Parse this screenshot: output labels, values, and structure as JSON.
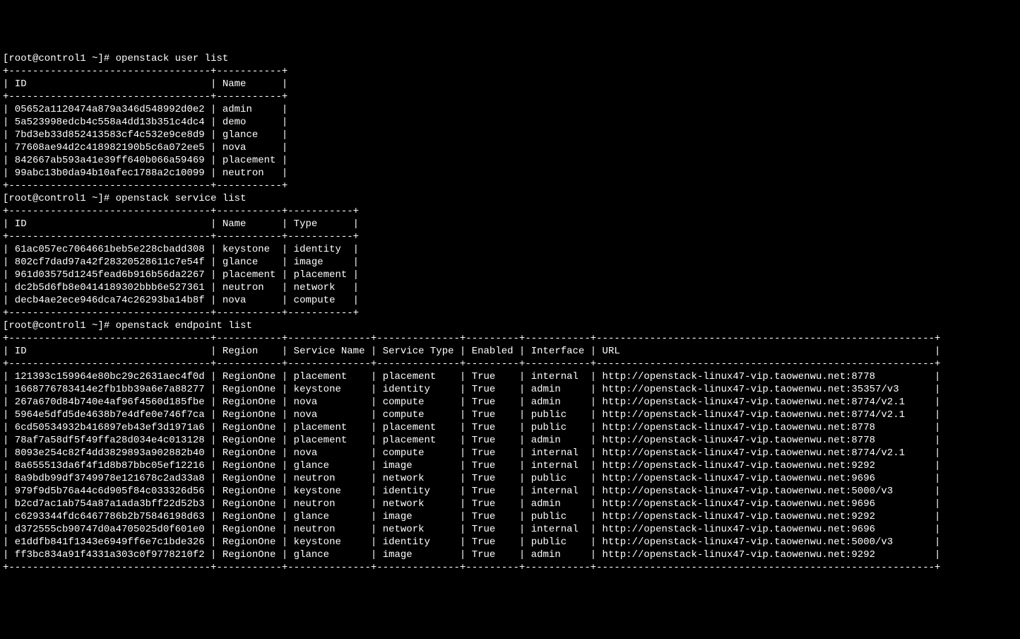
{
  "prompt": "[root@control1 ~]# ",
  "commands": {
    "user_list": "openstack user list",
    "service_list": "openstack service list",
    "endpoint_list": "openstack endpoint list"
  },
  "user_table": {
    "headers": [
      "ID",
      "Name"
    ],
    "widths": [
      34,
      11
    ],
    "rows": [
      [
        "05652a1120474a879a346d548992d0e2",
        "admin"
      ],
      [
        "5a523998edcb4c558a4dd13b351c4dc4",
        "demo"
      ],
      [
        "7bd3eb33d852413583cf4c532e9ce8d9",
        "glance"
      ],
      [
        "77608ae94d2c418982190b5c6a072ee5",
        "nova"
      ],
      [
        "842667ab593a41e39ff640b066a59469",
        "placement"
      ],
      [
        "99abc13b0da94b10afec1788a2c10099",
        "neutron"
      ]
    ]
  },
  "service_table": {
    "headers": [
      "ID",
      "Name",
      "Type"
    ],
    "widths": [
      34,
      11,
      11
    ],
    "rows": [
      [
        "61ac057ec7064661beb5e228cbadd308",
        "keystone",
        "identity"
      ],
      [
        "802cf7dad97a42f28320528611c7e54f",
        "glance",
        "image"
      ],
      [
        "961d03575d1245fead6b916b56da2267",
        "placement",
        "placement"
      ],
      [
        "dc2b5d6fb8e0414189302bbb6e527361",
        "neutron",
        "network"
      ],
      [
        "decb4ae2ece946dca74c26293ba14b8f",
        "nova",
        "compute"
      ]
    ]
  },
  "endpoint_table": {
    "headers": [
      "ID",
      "Region",
      "Service Name",
      "Service Type",
      "Enabled",
      "Interface",
      "URL"
    ],
    "widths": [
      34,
      11,
      14,
      14,
      9,
      11,
      57
    ],
    "rows": [
      [
        "121393c159964e80bc29c2631aec4f0d",
        "RegionOne",
        "placement",
        "placement",
        "True",
        "internal",
        "http://openstack-linux47-vip.taowenwu.net:8778"
      ],
      [
        "1668776783414e2fb1bb39a6e7a88277",
        "RegionOne",
        "keystone",
        "identity",
        "True",
        "admin",
        "http://openstack-linux47-vip.taowenwu.net:35357/v3"
      ],
      [
        "267a670d84b740e4af96f4560d185fbe",
        "RegionOne",
        "nova",
        "compute",
        "True",
        "admin",
        "http://openstack-linux47-vip.taowenwu.net:8774/v2.1"
      ],
      [
        "5964e5dfd5de4638b7e4dfe0e746f7ca",
        "RegionOne",
        "nova",
        "compute",
        "True",
        "public",
        "http://openstack-linux47-vip.taowenwu.net:8774/v2.1"
      ],
      [
        "6cd50534932b416897eb43ef3d1971a6",
        "RegionOne",
        "placement",
        "placement",
        "True",
        "public",
        "http://openstack-linux47-vip.taowenwu.net:8778"
      ],
      [
        "78af7a58df5f49ffa28d034e4c013128",
        "RegionOne",
        "placement",
        "placement",
        "True",
        "admin",
        "http://openstack-linux47-vip.taowenwu.net:8778"
      ],
      [
        "8093e254c82f4dd3829893a902882b40",
        "RegionOne",
        "nova",
        "compute",
        "True",
        "internal",
        "http://openstack-linux47-vip.taowenwu.net:8774/v2.1"
      ],
      [
        "8a655513da6f4f1d8b87bbc05ef12216",
        "RegionOne",
        "glance",
        "image",
        "True",
        "internal",
        "http://openstack-linux47-vip.taowenwu.net:9292"
      ],
      [
        "8a9bdb99df3749978e121678c2ad33a8",
        "RegionOne",
        "neutron",
        "network",
        "True",
        "public",
        "http://openstack-linux47-vip.taowenwu.net:9696"
      ],
      [
        "979f9d5b76a44c6d905f84c033326d56",
        "RegionOne",
        "keystone",
        "identity",
        "True",
        "internal",
        "http://openstack-linux47-vip.taowenwu.net:5000/v3"
      ],
      [
        "b2cd7ac1ab754a87a1ada3bff22d52b3",
        "RegionOne",
        "neutron",
        "network",
        "True",
        "admin",
        "http://openstack-linux47-vip.taowenwu.net:9696"
      ],
      [
        "c6293344fdc6467786b2b75846198d63",
        "RegionOne",
        "glance",
        "image",
        "True",
        "public",
        "http://openstack-linux47-vip.taowenwu.net:9292"
      ],
      [
        "d372555cb90747d0a4705025d0f601e0",
        "RegionOne",
        "neutron",
        "network",
        "True",
        "internal",
        "http://openstack-linux47-vip.taowenwu.net:9696"
      ],
      [
        "e1ddfb841f1343e6949ff6e7c1bde326",
        "RegionOne",
        "keystone",
        "identity",
        "True",
        "public",
        "http://openstack-linux47-vip.taowenwu.net:5000/v3"
      ],
      [
        "ff3bc834a91f4331a303c0f9778210f2",
        "RegionOne",
        "glance",
        "image",
        "True",
        "admin",
        "http://openstack-linux47-vip.taowenwu.net:9292"
      ]
    ]
  }
}
